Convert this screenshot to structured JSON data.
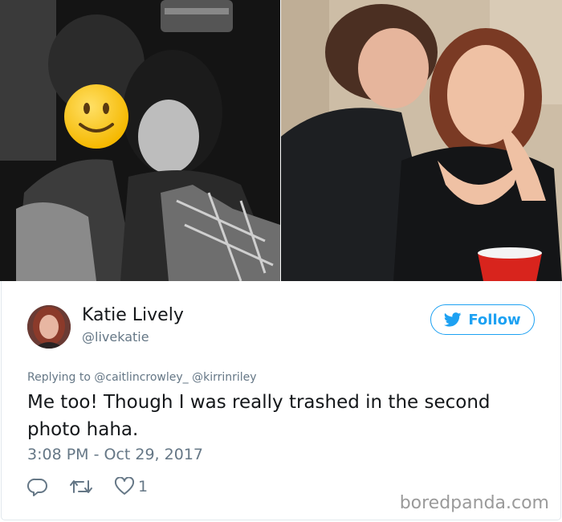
{
  "tweet": {
    "author": {
      "display_name": "Katie Lively",
      "handle": "@livekatie"
    },
    "follow_button": {
      "label": "Follow",
      "icon": "twitter-bird-icon",
      "color": "#1da1f2"
    },
    "reply_context": {
      "prefix": "Replying to",
      "mentions": [
        "@caitlincrowley_",
        "@kirrinriley"
      ]
    },
    "text": "Me too! Though I was really trashed in the second photo haha.",
    "timestamp": "3:08 PM - Oct 29, 2017",
    "actions": {
      "reply_icon": "reply-icon",
      "retweet_icon": "retweet-icon",
      "like_icon": "heart-icon",
      "like_count": "1"
    }
  },
  "watermark": "boredpanda.com"
}
